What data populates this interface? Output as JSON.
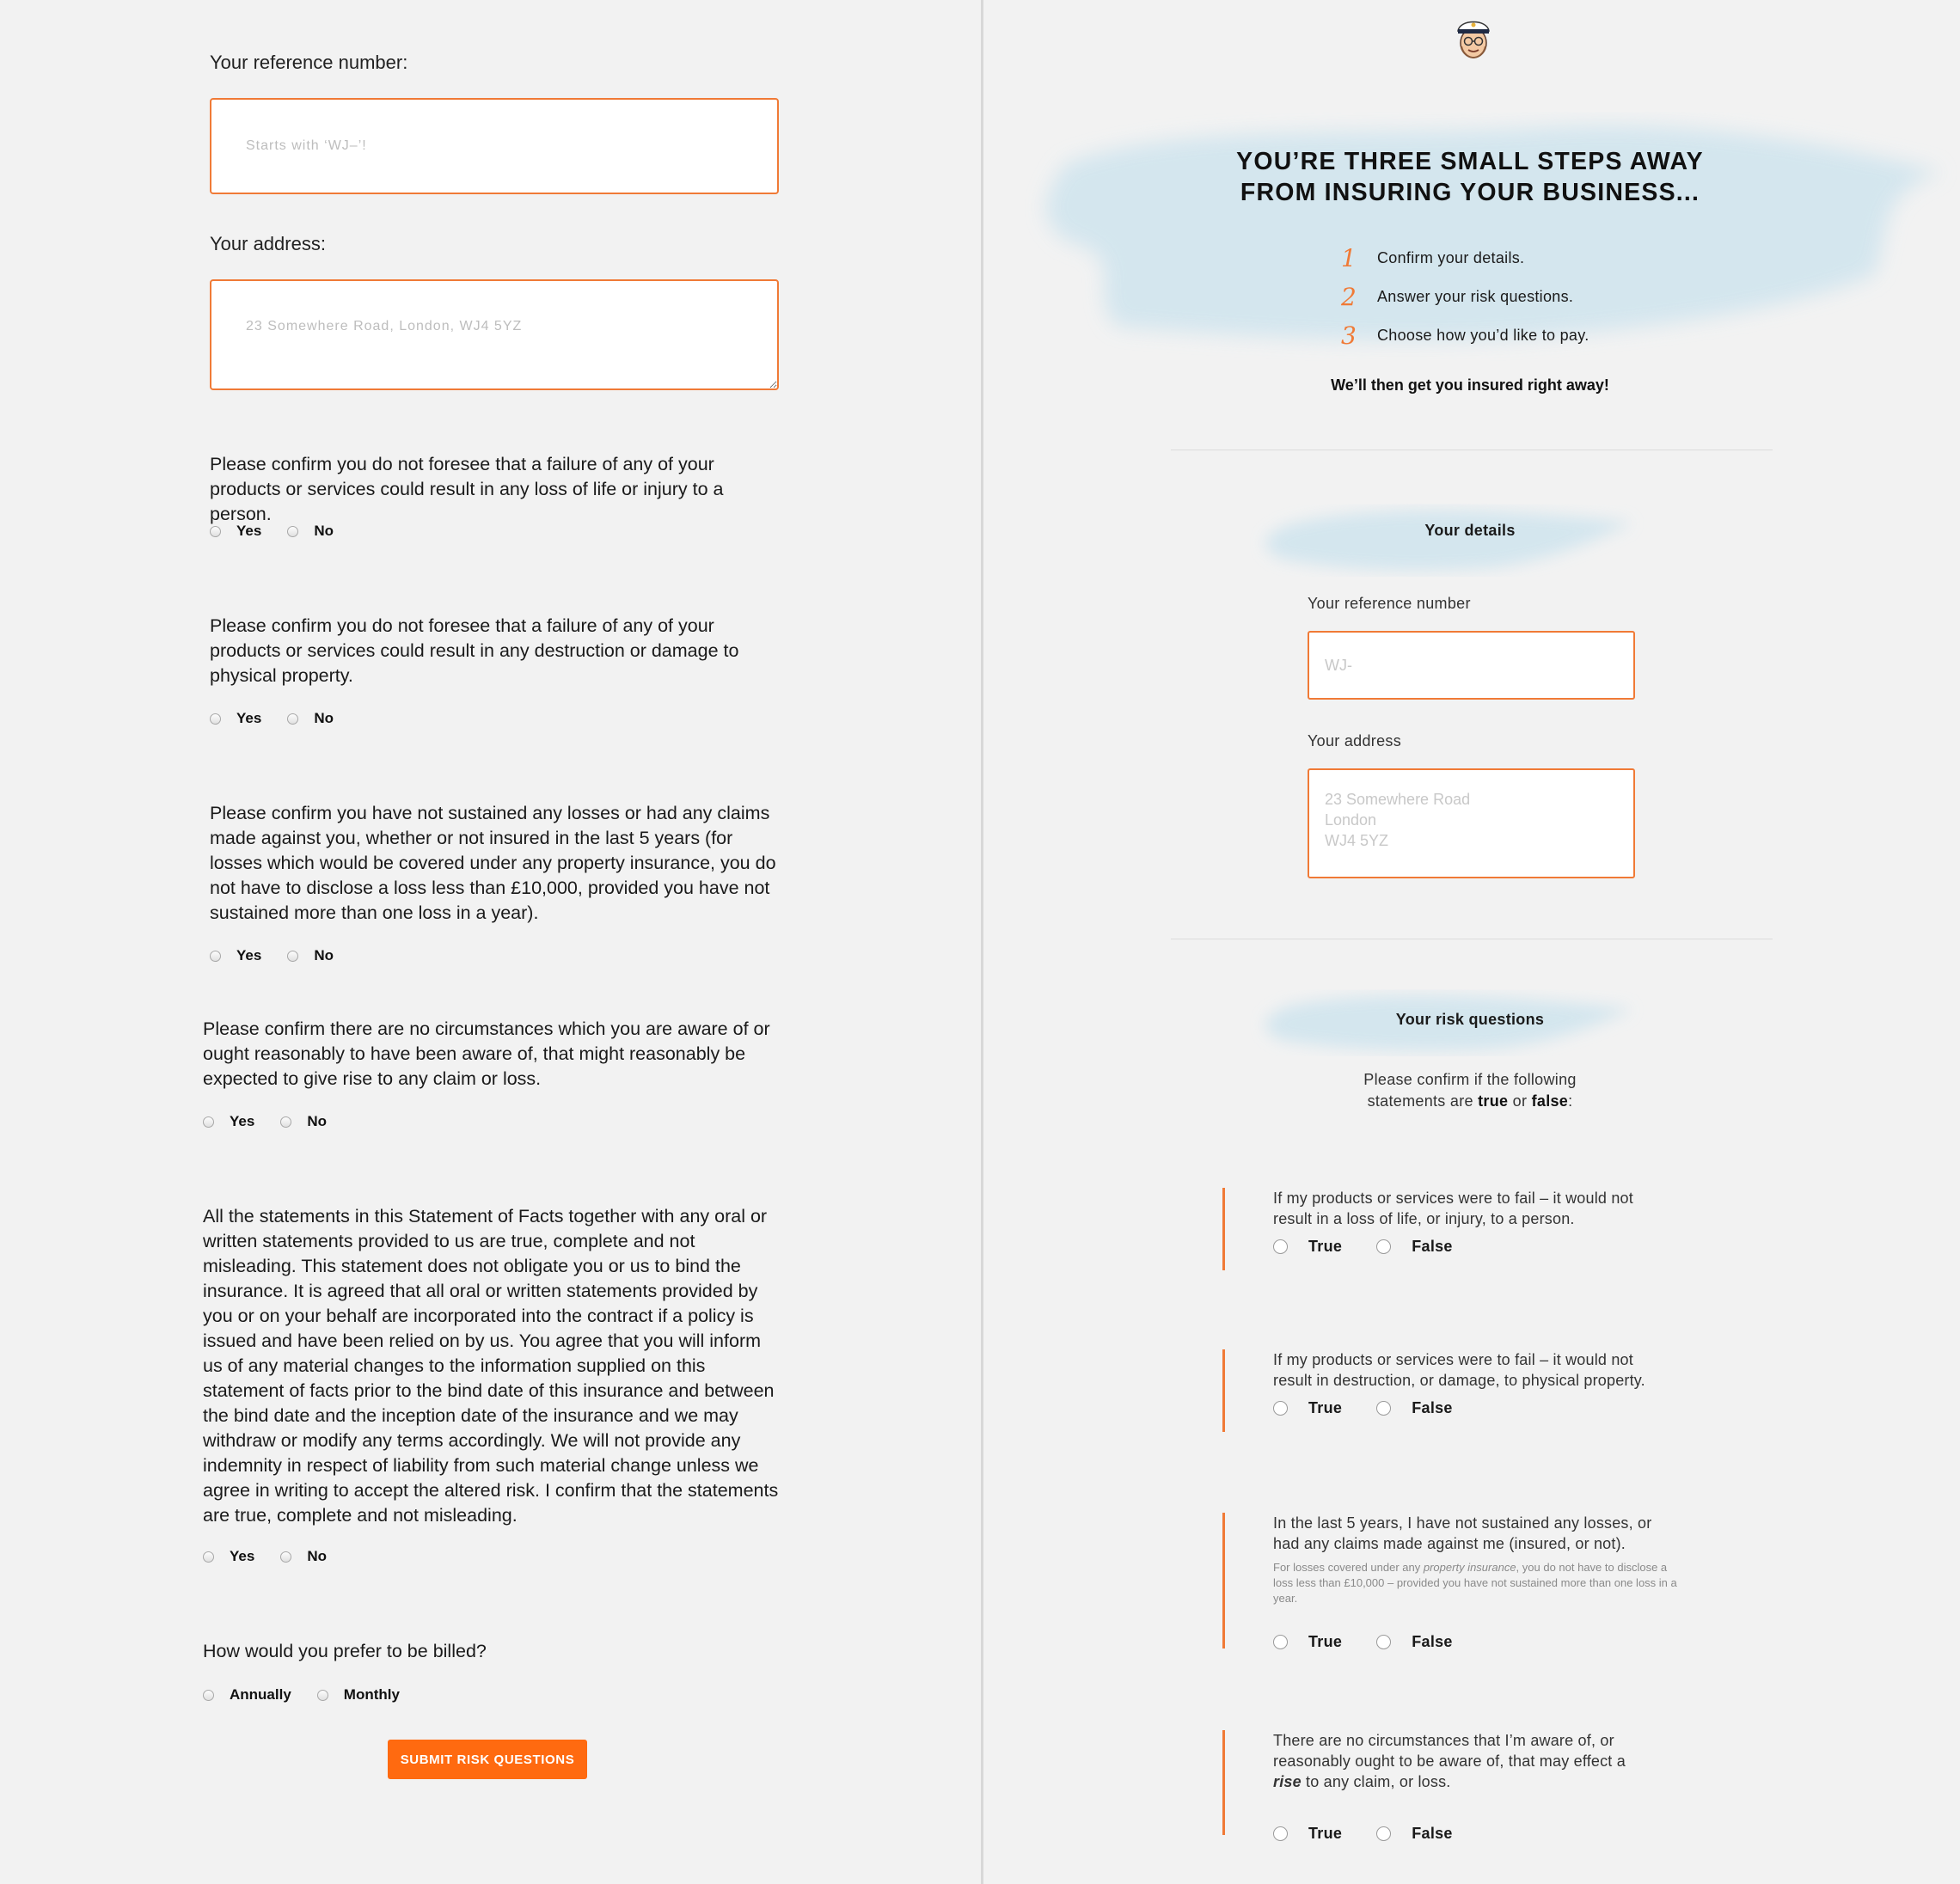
{
  "left": {
    "reference_label": "Your reference number:",
    "reference_placeholder": "Starts with ‘WJ–’!",
    "address_label": "Your address:",
    "address_placeholder": "23 Somewhere Road, London, WJ4 5YZ",
    "questions": [
      {
        "text": "Please confirm you do not foresee that a failure of any of your products or services could result in any loss of life or injury to a person.",
        "yes": "Yes",
        "no": "No"
      },
      {
        "text": "Please confirm you do not foresee that a failure of any of your products or services could result in any destruction or damage to physical property.",
        "yes": "Yes",
        "no": "No"
      },
      {
        "text": "Please confirm you have not sustained any losses or had any claims made against you, whether or not insured in the last 5 years (for losses which would be covered under any property insurance, you do not have to disclose a loss less than £10,000, provided you have not sustained more than one loss in a year).",
        "yes": "Yes",
        "no": "No"
      },
      {
        "text": "Please confirm there are no circumstances which you are aware of or ought reasonably to have been aware of, that might reasonably be expected to give rise to any claim or loss.",
        "yes": "Yes",
        "no": "No"
      },
      {
        "text": "All the statements in this Statement of Facts together with any oral or written statements provided to us are true, complete and not misleading. This statement does not obligate you or us to bind the insurance. It is agreed that all oral or written statements provided by you or on your behalf are incorporated into the contract if a policy is issued and have been relied on by us. You agree that you will inform us of any material changes to the information supplied on this statement of facts prior to the bind date of this insurance and between the bind date and the inception date of the insurance and we may withdraw or modify any terms accordingly. We will not provide any indemnity in respect of liability from such material change unless we agree in writing to accept the altered risk. I confirm that the statements are true, complete and not misleading.",
        "yes": "Yes",
        "no": "No"
      }
    ],
    "billing_question": "How would you prefer to be billed?",
    "billing_annually": "Annually",
    "billing_monthly": "Monthly",
    "submit_label": "SUBMIT RISK QUESTIONS"
  },
  "right": {
    "avatar_icon": "captain-avatar-icon",
    "title_line1": "YOU’RE THREE SMALL STEPS AWAY",
    "title_line2": "FROM INSURING YOUR BUSINESS...",
    "steps": [
      {
        "num": "1",
        "text": "Confirm your details."
      },
      {
        "num": "2",
        "text": "Answer your risk questions."
      },
      {
        "num": "3",
        "text": "Choose how you’d like to pay."
      }
    ],
    "insured_line": "We’ll then get you insured right away!",
    "details_title": "Your details",
    "reference_label": "Your reference number",
    "reference_placeholder": "WJ-",
    "address_label": "Your address",
    "address_placeholder": "23 Somewhere Road\nLondon\nWJ4 5YZ",
    "risk_title": "Your risk questions",
    "confirm_intro_1": "Please confirm if the following",
    "confirm_intro_2": "statements are",
    "confirm_true_word": "true",
    "confirm_or": "or",
    "confirm_false_word": "false",
    "confirm_colon": ":",
    "questions": [
      {
        "line1": "If my products or services were to fail – it would not",
        "line2": "result in a loss of life, or injury, to a person.",
        "true": "True",
        "false": "False"
      },
      {
        "line1": "If my products or services were to fail – it would not",
        "line2": "result in destruction, or damage, to physical property.",
        "true": "True",
        "false": "False"
      },
      {
        "line1": "In the last 5 years, I have not sustained any losses, or",
        "line2": "had any claims made against me (insured, or not).",
        "note_pre": "For losses covered under any ",
        "note_em": "property insurance",
        "note_post": ", you do not have to disclose a loss less than £10,000 – provided you have not sustained more than one loss in a year.",
        "true": "True",
        "false": "False"
      },
      {
        "line1": "There are no circumstances that I’m aware of, or",
        "line2": "reasonably ought to be aware of, that may effect a",
        "line3_em": "rise",
        "line3_rest": " to any claim, or loss.",
        "true": "True",
        "false": "False"
      }
    ]
  },
  "colors": {
    "accent": "#f07a36",
    "button": "#ff6a10",
    "background": "#f2f2f2",
    "brush": "#cfe4ee"
  }
}
